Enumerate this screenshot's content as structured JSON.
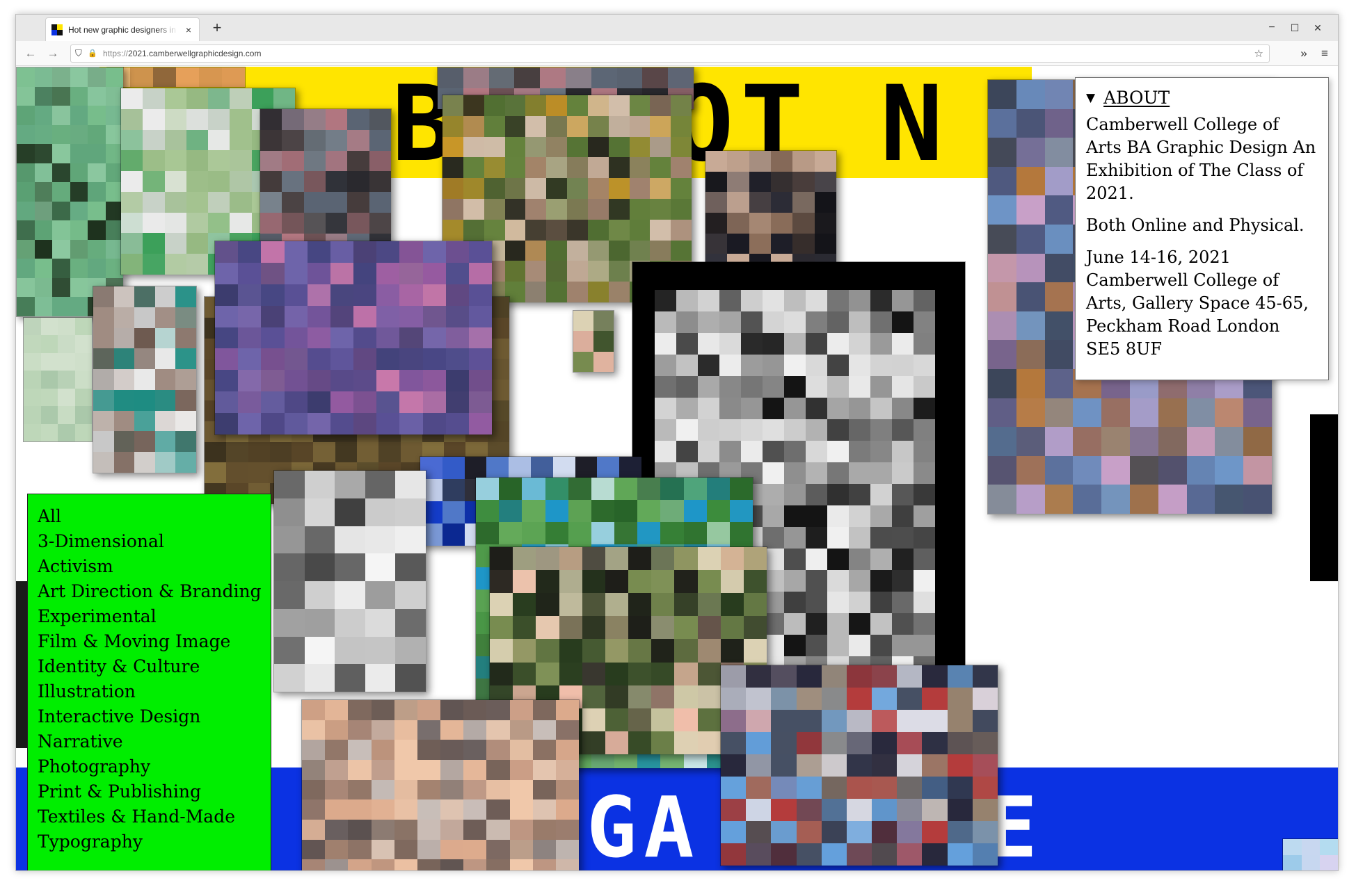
{
  "browser": {
    "tab_title": "Hot new graphic designers in your",
    "tab_close": "×",
    "new_tab": "+",
    "url_scheme": "https://",
    "url_host": "2021.camberwellgraphicdesign.com",
    "window_controls": {
      "minimize": "−",
      "maximize": "☐",
      "close": "✕"
    },
    "nav_icons": {
      "back": "←",
      "forward": "→",
      "shield": "⛉",
      "lock": "🔒",
      "bookmark": "☆",
      "overflow": "»",
      "menu": "≡"
    }
  },
  "banners": {
    "top_text": "BE HOT N",
    "bottom_text": "GA  SPACE"
  },
  "about": {
    "toggle_icon": "▼",
    "toggle_label": "ABOUT",
    "paragraph_1": "Camberwell College of Arts BA Graphic Design An Exhibition of The Class of 2021.",
    "paragraph_2": "Both Online and Physical.",
    "paragraph_3": "June 14-16, 2021 Camberwell College of Arts, Gallery Space 45-65, Peckham Road London SE5 8UF"
  },
  "filters": [
    "All",
    "3-Dimensional",
    "Activism",
    "Art Direction & Branding",
    "Experimental",
    "Film & Moving Image",
    "Identity & Culture",
    "Illustration",
    "Interactive Design",
    "Narrative",
    "Photography",
    "Print & Publishing",
    "Textiles & Hand-Made",
    "Typography"
  ],
  "colors": {
    "banner_yellow": "#ffe500",
    "banner_blue": "#0b32e3",
    "filter_green": "#00ee00"
  }
}
